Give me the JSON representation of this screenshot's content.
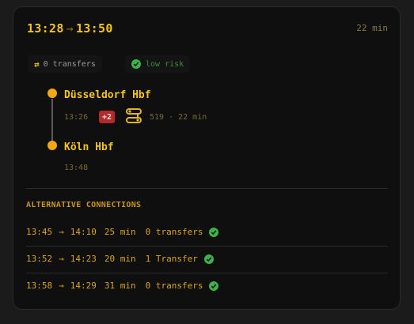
{
  "header": {
    "departure": "13:28",
    "arrow": "→",
    "arrival": "13:50",
    "duration": "22 min"
  },
  "chips": {
    "transfers_icon": "swap-arrows-icon",
    "transfers": "0 transfers",
    "risk_icon": "check-circle-icon",
    "risk": "low risk"
  },
  "journey": {
    "origin": {
      "name": "Düsseldorf Hbf",
      "time": "13:26",
      "delay": "+2"
    },
    "leg": {
      "icon": "train-route-icon",
      "info": "519 · 22 min"
    },
    "destination": {
      "name": "Köln Hbf",
      "time": "13:48"
    }
  },
  "alternatives": {
    "title": "ALTERNATIVE CONNECTIONS",
    "rows": [
      {
        "dep": "13:45",
        "arrow": "→",
        "arr": "14:10",
        "duration": "25 min",
        "transfers": "0 transfers"
      },
      {
        "dep": "13:52",
        "arrow": "→",
        "arr": "14:23",
        "duration": "20 min",
        "transfers": "1 Transfer"
      },
      {
        "dep": "13:58",
        "arrow": "→",
        "arr": "14:29",
        "duration": "31 min",
        "transfers": "0 transfers"
      }
    ]
  },
  "colors": {
    "accent": "#f5c518",
    "dot": "#f5a70e",
    "delay": "#b42a2a",
    "success": "#3bb24a"
  }
}
